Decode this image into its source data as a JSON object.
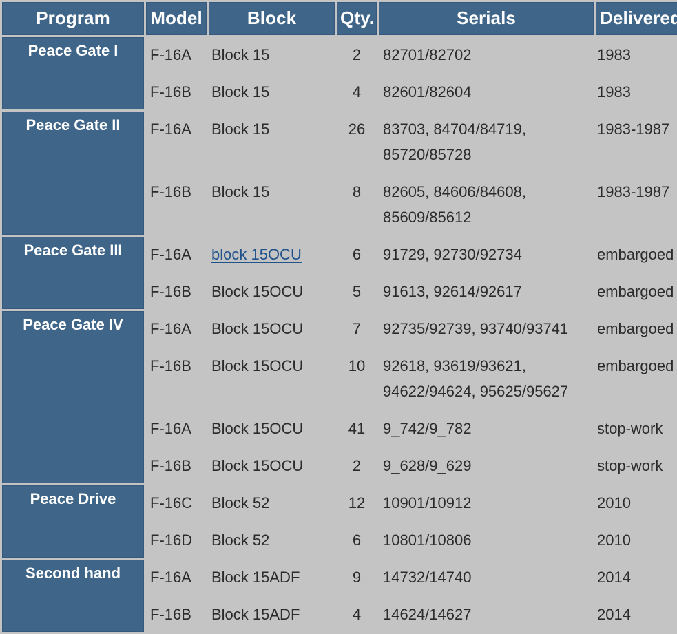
{
  "table": {
    "columns": [
      {
        "key": "program",
        "label": "Program"
      },
      {
        "key": "model",
        "label": "Model"
      },
      {
        "key": "block",
        "label": "Block"
      },
      {
        "key": "qty",
        "label": "Qty."
      },
      {
        "key": "serials",
        "label": "Serials"
      },
      {
        "key": "delivered",
        "label": "Delivered"
      }
    ],
    "colors": {
      "header_bg": "#3f6589",
      "header_text": "#ffffff",
      "body_bg": "#c4c4c4",
      "body_text": "#2b2b2b",
      "link": "#20528c",
      "cell_border": "#35597c"
    },
    "groups": [
      {
        "program": "Peace Gate I",
        "rows": [
          {
            "model": "F-16A",
            "block": "Block 15",
            "block_is_link": false,
            "qty": "2",
            "serials": [
              "82701/82702"
            ],
            "delivered": "1983"
          },
          {
            "model": "F-16B",
            "block": "Block 15",
            "block_is_link": false,
            "qty": "4",
            "serials": [
              "82601/82604"
            ],
            "delivered": "1983"
          }
        ]
      },
      {
        "program": "Peace Gate II",
        "rows": [
          {
            "model": "F-16A",
            "block": "Block 15",
            "block_is_link": false,
            "qty": "26",
            "serials": [
              "83703, 84704/84719,",
              "85720/85728"
            ],
            "delivered": "1983-1987"
          },
          {
            "model": "F-16B",
            "block": "Block 15",
            "block_is_link": false,
            "qty": "8",
            "serials": [
              "82605, 84606/84608,",
              "85609/85612"
            ],
            "delivered": "1983-1987"
          }
        ]
      },
      {
        "program": "Peace Gate III",
        "rows": [
          {
            "model": "F-16A",
            "block": "block 15OCU",
            "block_is_link": true,
            "qty": "6",
            "serials": [
              "91729, 92730/92734"
            ],
            "delivered": "embargoed"
          },
          {
            "model": "F-16B",
            "block": "Block 15OCU",
            "block_is_link": false,
            "qty": "5",
            "serials": [
              "91613, 92614/92617"
            ],
            "delivered": "embargoed"
          }
        ]
      },
      {
        "program": "Peace Gate IV",
        "rows": [
          {
            "model": "F-16A",
            "block": "Block 15OCU",
            "block_is_link": false,
            "qty": "7",
            "serials": [
              "92735/92739, 93740/93741"
            ],
            "delivered": "embargoed"
          },
          {
            "model": "F-16B",
            "block": "Block 15OCU",
            "block_is_link": false,
            "qty": "10",
            "serials": [
              "92618, 93619/93621,",
              "94622/94624, 95625/95627"
            ],
            "delivered": "embargoed"
          },
          {
            "model": "F-16A",
            "block": "Block 15OCU",
            "block_is_link": false,
            "qty": "41",
            "serials": [
              "9_742/9_782"
            ],
            "delivered": "stop-work"
          },
          {
            "model": "F-16B",
            "block": "Block 15OCU",
            "block_is_link": false,
            "qty": "2",
            "serials": [
              "9_628/9_629"
            ],
            "delivered": "stop-work"
          }
        ]
      },
      {
        "program": "Peace Drive",
        "rows": [
          {
            "model": "F-16C",
            "block": "Block 52",
            "block_is_link": false,
            "qty": "12",
            "serials": [
              "10901/10912"
            ],
            "delivered": "2010"
          },
          {
            "model": "F-16D",
            "block": "Block 52",
            "block_is_link": false,
            "qty": "6",
            "serials": [
              "10801/10806"
            ],
            "delivered": "2010"
          }
        ]
      },
      {
        "program": "Second hand",
        "rows": [
          {
            "model": "F-16A",
            "block": "Block 15ADF",
            "block_is_link": false,
            "qty": "9",
            "serials": [
              "14732/14740"
            ],
            "delivered": "2014"
          },
          {
            "model": "F-16B",
            "block": "Block 15ADF",
            "block_is_link": false,
            "qty": "4",
            "serials": [
              "14624/14627"
            ],
            "delivered": "2014"
          }
        ]
      }
    ]
  }
}
